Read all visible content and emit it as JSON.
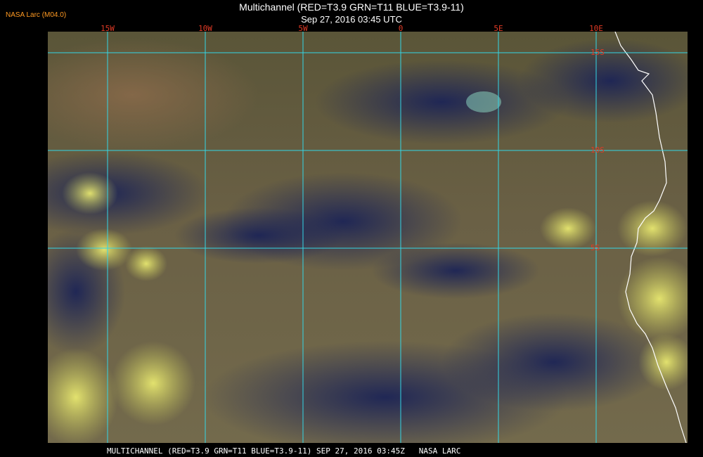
{
  "header": {
    "source_tag": "NASA Larc (M04.0)",
    "title": "Multichannel (RED=T3.9 GRN=T11 BLUE=T3.9-11)",
    "datetime": "Sep 27, 2016 03:45 UTC"
  },
  "grid": {
    "longitudes": [
      {
        "label": "15W",
        "value": -15
      },
      {
        "label": "10W",
        "value": -10
      },
      {
        "label": "5W",
        "value": -5
      },
      {
        "label": "0",
        "value": 0
      },
      {
        "label": "5E",
        "value": 5
      },
      {
        "label": "10E",
        "value": 10
      }
    ],
    "latitudes": [
      {
        "label": "5S",
        "value": -5
      },
      {
        "label": "10S",
        "value": -10
      },
      {
        "label": "15S",
        "value": -15
      },
      {
        "label": "20S",
        "value": -20
      }
    ]
  },
  "colors": {
    "gridline": "#33d6e6",
    "label": "#e13a25",
    "coastline": "#ffffff",
    "tag": "#ff9a22"
  },
  "footer": {
    "text": "MULTICHANNEL (RED=T3.9 GRN=T11 BLUE=T3.9-11) SEP 27, 2016 03:45Z   NASA LARC"
  }
}
